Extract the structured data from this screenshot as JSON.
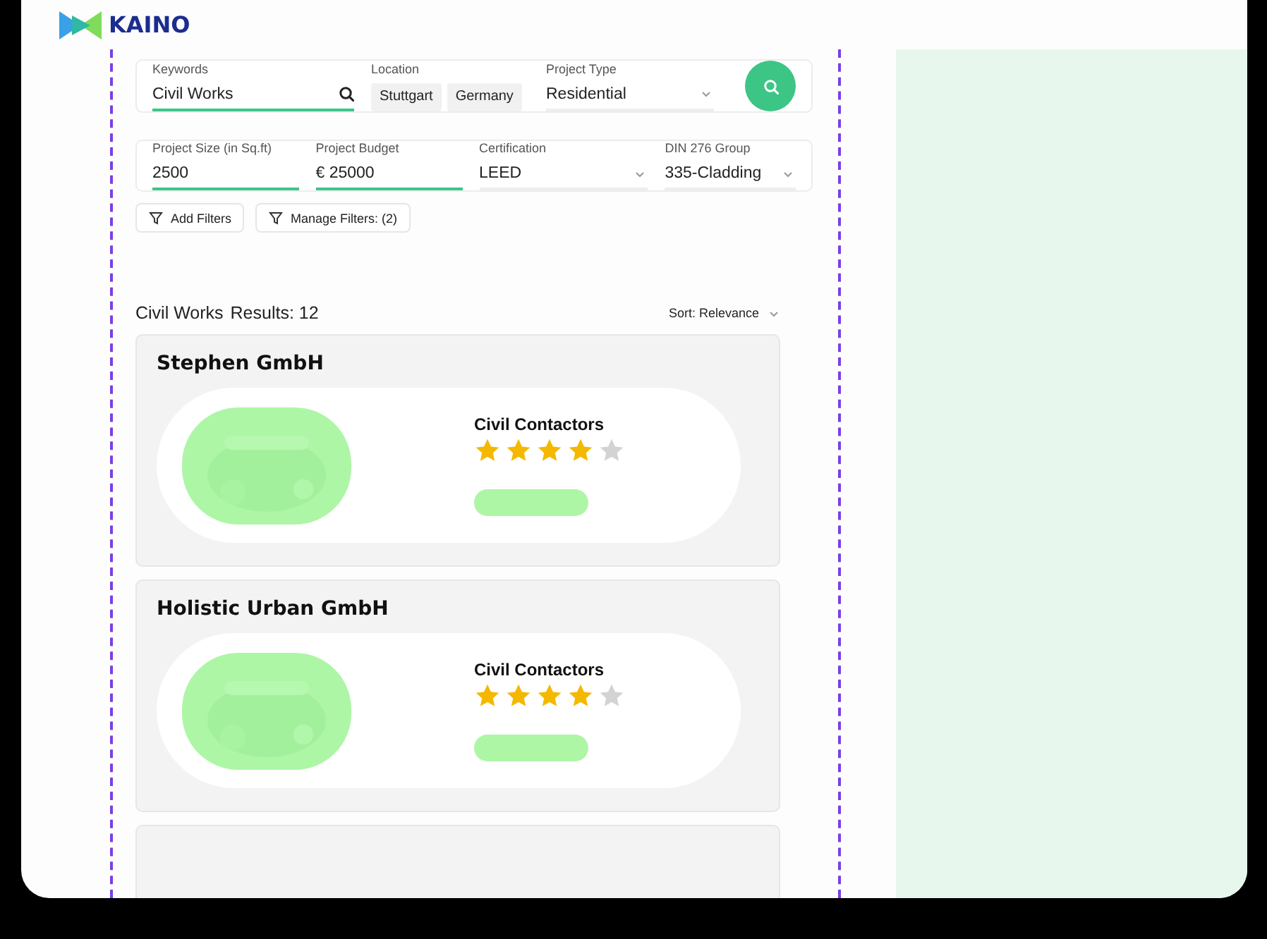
{
  "logo": {
    "text": "KAINO"
  },
  "search": {
    "fields": [
      {
        "kind": "text",
        "label": "Keywords",
        "value": "Civil Works"
      },
      {
        "kind": "chips",
        "label": "Location",
        "chips": [
          "Stuttgart",
          "Germany"
        ]
      },
      {
        "kind": "select",
        "label": "Project Type",
        "value": "Residential"
      }
    ]
  },
  "filters": {
    "fields": [
      {
        "kind": "text",
        "label": "Project Size (in Sq.ft)",
        "value": "2500"
      },
      {
        "kind": "text",
        "label": "Project Budget",
        "value": "€ 25000"
      },
      {
        "kind": "select",
        "label": "Certification",
        "value": "LEED"
      },
      {
        "kind": "select",
        "label": "DIN 276  Group",
        "value": "335-Cladding"
      }
    ]
  },
  "filter_buttons": [
    "Add Filters",
    "Manage Filters: (2)"
  ],
  "results": {
    "query": "Civil Works",
    "count": "Results: 12",
    "sort": "Sort: Relevance"
  },
  "cards": [
    {
      "kind": "full",
      "name": "Stephen GmbH",
      "category": "Civil Contactors",
      "stars": 4
    },
    {
      "kind": "full",
      "name": "Holistic Urban GmbH",
      "category": "Civil Contactors",
      "stars": 4
    },
    {
      "kind": "edge"
    }
  ]
}
